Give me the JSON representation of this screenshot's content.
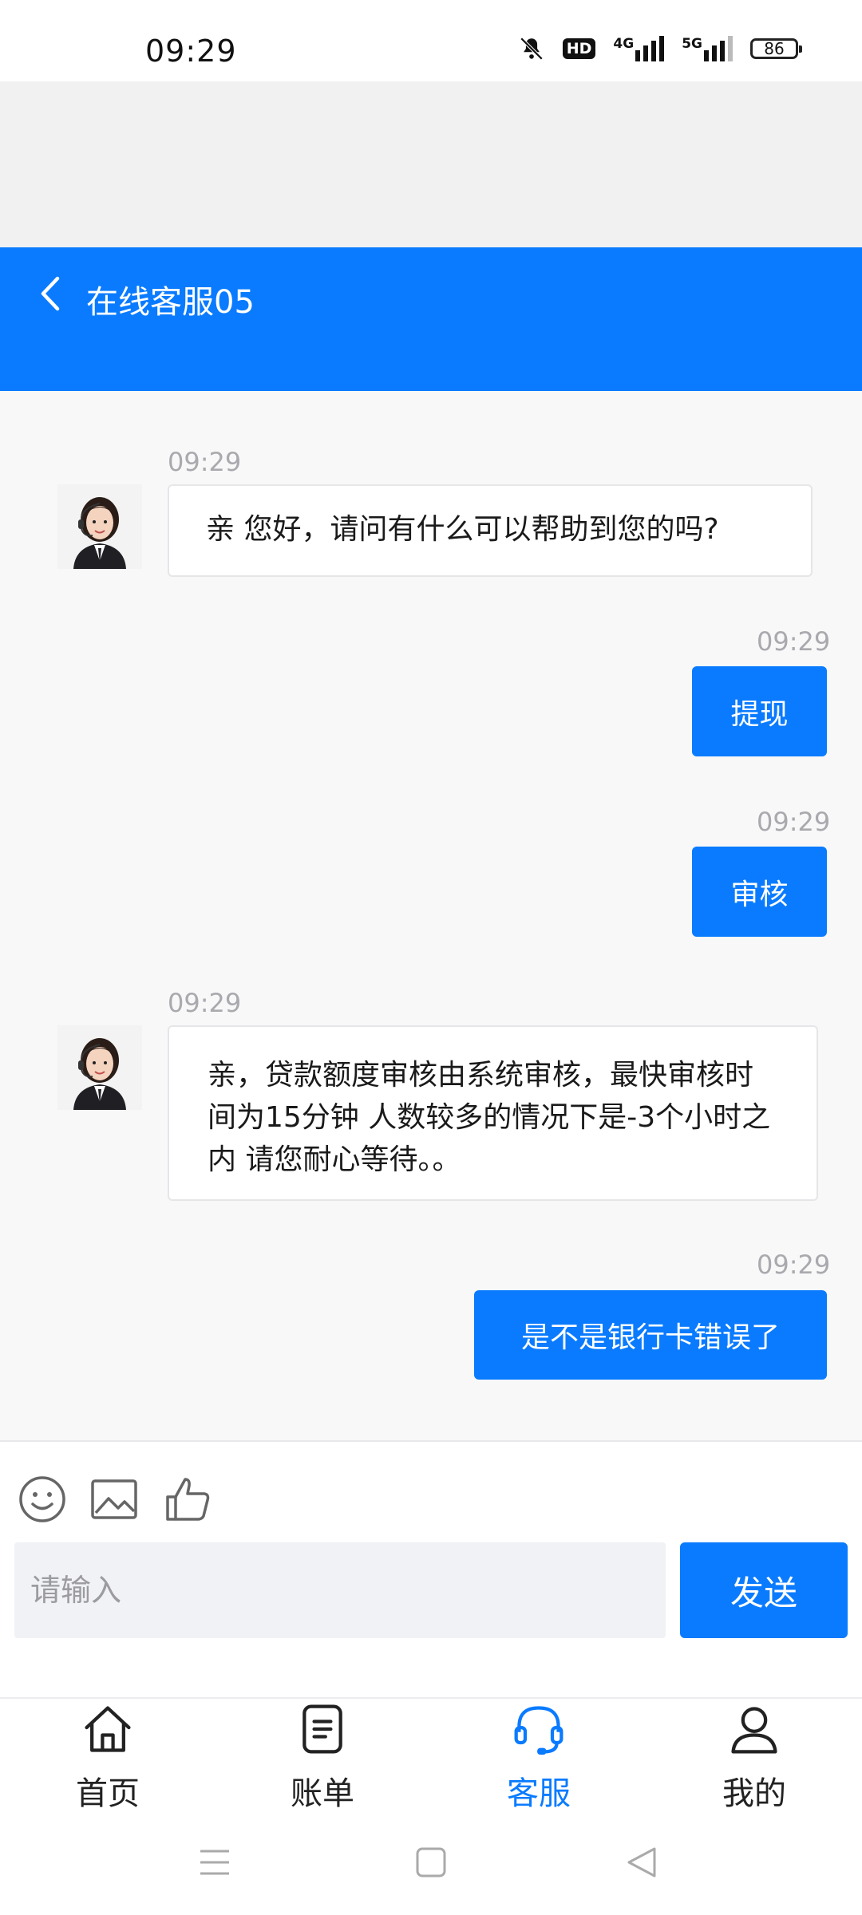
{
  "status_bar": {
    "time": "09:29",
    "hd_label": "HD",
    "net1_label": "4G",
    "net2_label": "5G",
    "battery": "86",
    "icons": [
      "mute-bell-icon",
      "hd-icon",
      "signal-4g-icon",
      "signal-5g-icon",
      "battery-icon"
    ]
  },
  "header": {
    "title": "在线客服05",
    "back_icon": "chevron-left-icon"
  },
  "messages": [
    {
      "side": "in",
      "time": "09:29",
      "text": "亲 您好，请问有什么可以帮助到您的吗?"
    },
    {
      "side": "out",
      "time": "09:29",
      "text": "提现"
    },
    {
      "side": "out",
      "time": "09:29",
      "text": "审核"
    },
    {
      "side": "in",
      "time": "09:29",
      "text": "亲，贷款额度审核由系统审核，最快审核时间为15分钟 人数较多的情况下是-3个小时之内 请您耐心等待。。"
    },
    {
      "side": "out",
      "time": "09:29",
      "text": "是不是银行卡错误了"
    }
  ],
  "composer": {
    "tools": [
      "emoji-icon",
      "image-icon",
      "thumbs-up-icon"
    ],
    "placeholder": "请输入",
    "send_label": "发送"
  },
  "bottom_nav": {
    "items": [
      {
        "label": "首页",
        "icon": "home-icon",
        "active": false
      },
      {
        "label": "账单",
        "icon": "bill-icon",
        "active": false
      },
      {
        "label": "客服",
        "icon": "headset-icon",
        "active": true
      },
      {
        "label": "我的",
        "icon": "user-icon",
        "active": false
      }
    ]
  },
  "colors": {
    "accent": "#0a7bff",
    "background": "#f8f8f9",
    "timestamp": "#a9a9ae"
  }
}
